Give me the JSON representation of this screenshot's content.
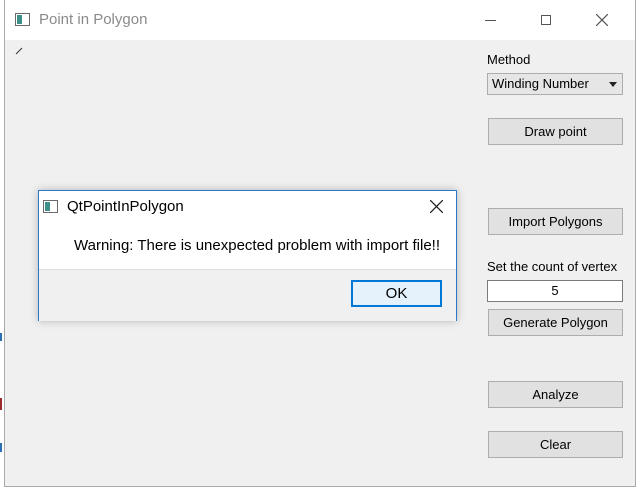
{
  "window": {
    "title": "Point in Polygon"
  },
  "controls": {
    "method_label": "Method",
    "method_selected": "Winding Number",
    "draw_point_label": "Draw point",
    "import_polygons_label": "Import Polygons",
    "vertex_count_label": "Set the count of vertex",
    "vertex_count_value": "5",
    "generate_polygon_label": "Generate Polygon",
    "analyze_label": "Analyze",
    "clear_label": "Clear"
  },
  "dialog": {
    "title": "QtPointInPolygon",
    "message": "Warning: There is unexpected problem with import file!!",
    "ok_label": "OK"
  },
  "colors": {
    "accent": "#0078d7",
    "app_icon": "#3d8f8a"
  },
  "icons": [
    "app-icon",
    "minimize-icon",
    "maximize-icon",
    "close-icon",
    "dropdown-arrow-icon",
    "dialog-app-icon",
    "dialog-close-icon"
  ]
}
